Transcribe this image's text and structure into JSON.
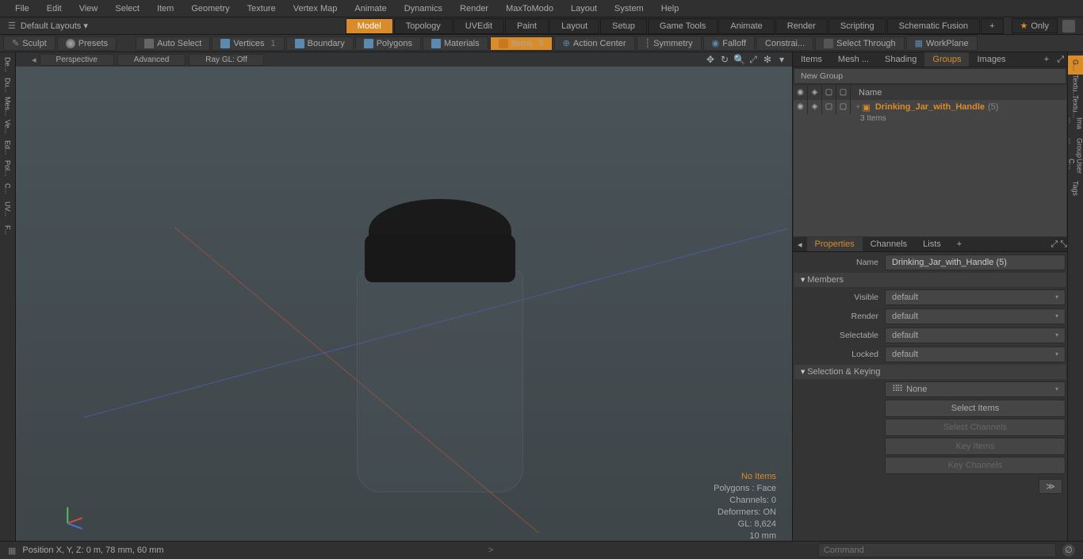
{
  "menu": [
    "File",
    "Edit",
    "View",
    "Select",
    "Item",
    "Geometry",
    "Texture",
    "Vertex Map",
    "Animate",
    "Dynamics",
    "Render",
    "MaxToModo",
    "Layout",
    "System",
    "Help"
  ],
  "layout": {
    "default": "Default Layouts ▾",
    "tabs": [
      "Model",
      "Topology",
      "UVEdit",
      "Paint",
      "Layout",
      "Setup",
      "Game Tools",
      "Animate",
      "Render",
      "Scripting",
      "Schematic Fusion"
    ],
    "active": "Model",
    "only": "Only"
  },
  "toolbar": {
    "sculpt": "Sculpt",
    "presets": "Presets",
    "autoselect": "Auto Select",
    "vertices": "Vertices",
    "boundary": "Boundary",
    "polygons": "Polygons",
    "materials": "Materials",
    "items": "Items",
    "actioncenter": "Action Center",
    "symmetry": "Symmetry",
    "falloff": "Falloff",
    "constrai": "Constrai...",
    "selectthrough": "Select Through",
    "workplane": "WorkPlane"
  },
  "ltools": [
    "De...",
    "Du...",
    "Mes...",
    "Ve...",
    "Ed...",
    "Pol...",
    "C...",
    "UV...",
    "F..."
  ],
  "rtools": [
    "G...",
    "Textu...",
    "Textu...",
    "Ima ...",
    "Group ...",
    "User C...",
    "Tags"
  ],
  "viewport": {
    "perspective": "Perspective",
    "advanced": "Advanced",
    "raygl": "Ray GL: Off",
    "info": {
      "noitems": "No Items",
      "polygons": "Polygons : Face",
      "channels": "Channels: 0",
      "deformers": "Deformers: ON",
      "gl": "GL: 8,624",
      "mm": "10 mm"
    }
  },
  "outliner": {
    "tabs": [
      "Items",
      "Mesh ...",
      "Shading",
      "Groups",
      "Images"
    ],
    "active": "Groups",
    "newgroup": "New Group",
    "namehdr": "Name",
    "item": "Drinking_Jar_with_Handle",
    "itemcount": "(5)",
    "subcount": "3 Items"
  },
  "properties": {
    "tabs": [
      "Properties",
      "Channels",
      "Lists"
    ],
    "active": "Properties",
    "name_label": "Name",
    "name_value": "Drinking_Jar_with_Handle (5)",
    "members": "Members",
    "visible_label": "Visible",
    "visible_value": "default",
    "render_label": "Render",
    "render_value": "default",
    "selectable_label": "Selectable",
    "selectable_value": "default",
    "locked_label": "Locked",
    "locked_value": "default",
    "selkey": "Selection & Keying",
    "none": "None",
    "selectitems": "Select Items",
    "selectchannels": "Select Channels",
    "keyitems": "Key Items",
    "keychannels": "Key Channels"
  },
  "status": {
    "position": "Position X, Y, Z:   0 m, 78 mm, 60 mm",
    "command": "Command"
  }
}
